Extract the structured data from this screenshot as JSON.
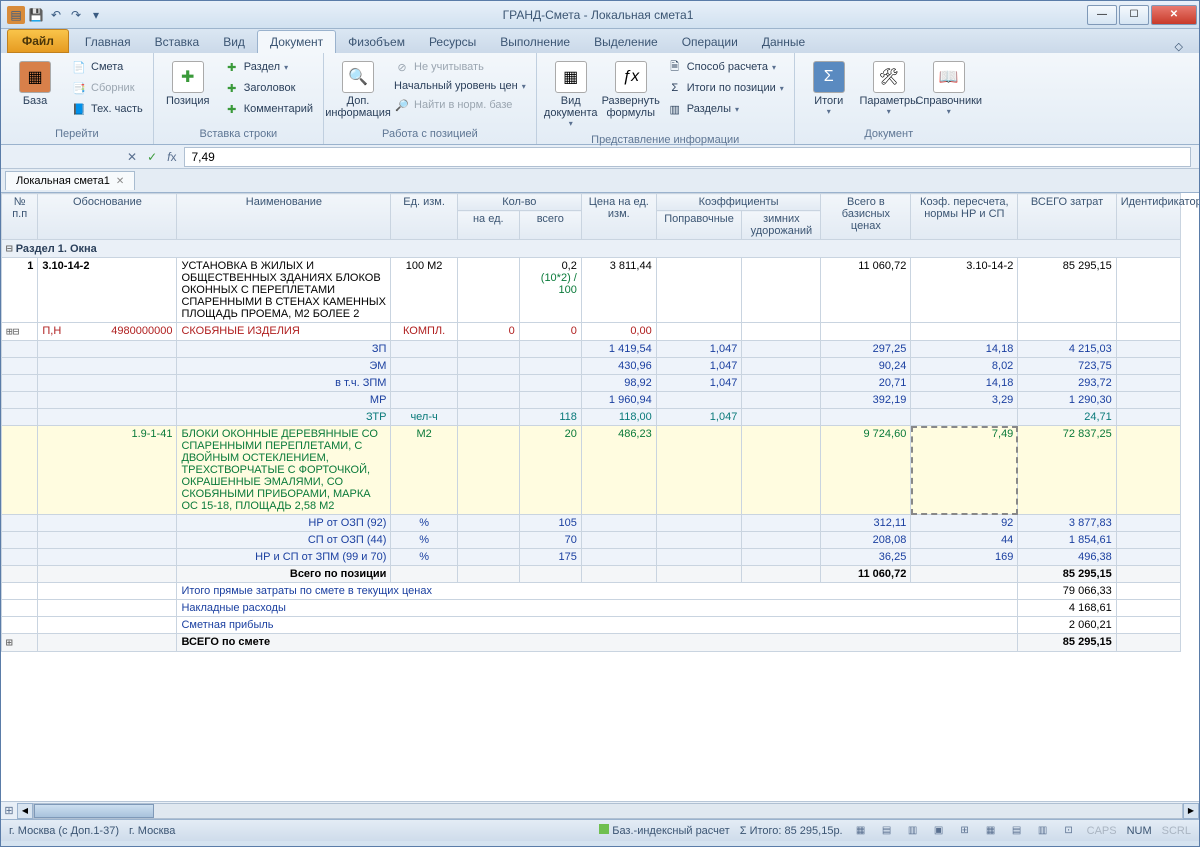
{
  "title": "ГРАНД-Смета - Локальная смета1",
  "tabs": {
    "file": "Файл",
    "main": "Главная",
    "insert": "Вставка",
    "view": "Вид",
    "document": "Документ",
    "phys": "Физобъем",
    "res": "Ресурсы",
    "exec": "Выполнение",
    "select": "Выделение",
    "ops": "Операции",
    "data": "Данные"
  },
  "ribbon": {
    "g1": {
      "baza": "База",
      "smeta": "Смета",
      "sbornik": "Сборник",
      "tech": "Тех. часть",
      "title": "Перейти"
    },
    "g2": {
      "pos": "Позиция",
      "razdel": "Раздел",
      "zag": "Заголовок",
      "kom": "Комментарий",
      "title": "Вставка строки"
    },
    "g3": {
      "dop": "Доп.\nинформация",
      "ne": "Не учитывать",
      "nach": "Начальный уровень цен",
      "najti": "Найти в норм. базе",
      "title": "Работа с позицией"
    },
    "g4": {
      "viddoc": "Вид\nдокумента",
      "razv": "Развернуть\nформулы",
      "spos": "Способ расчета",
      "itogi": "Итоги по позиции",
      "razd": "Разделы",
      "title": "Представление информации"
    },
    "g5": {
      "itog": "Итоги",
      "param": "Параметры",
      "sprav": "Справочники",
      "title": "Документ"
    }
  },
  "formula": {
    "value": "7,49"
  },
  "doctab": "Локальная смета1",
  "headers": {
    "npp": "№\nп.п",
    "obos": "Обоснование",
    "naim": "Наименование",
    "ed": "Ед. изм.",
    "kolvo": "Кол-во",
    "naed": "на ед.",
    "vsego": "всего",
    "cena": "Цена на ед. изм.",
    "koef": "Коэффициенты",
    "popr": "Поправочные",
    "zim": "зимних удорожаний",
    "vsegobaz": "Всего в базисных ценах",
    "kper": "Коэф. пересчета, нормы НР и СП",
    "vzat": "ВСЕГО затрат",
    "ident": "Идентификатор"
  },
  "section1": "Раздел 1. Окна",
  "rows": [
    {
      "n": "1",
      "obos": "3.10-14-2",
      "naim": "УСТАНОВКА В ЖИЛЫХ И ОБЩЕСТВЕННЫХ ЗДАНИЯХ БЛОКОВ ОКОННЫХ С ПЕРЕПЛЕТАМИ СПАРЕННЫМИ В СТЕНАХ КАМЕННЫХ ПЛОЩАДЬ ПРОЕМА, М2 БОЛЕЕ 2",
      "ed": "100 М2",
      "vsego": "0,2",
      "formula": "(10*2) / 100",
      "cena": "3 811,44",
      "baz": "11 060,72",
      "kper": "3.10-14-2",
      "zat": "85 295,15"
    },
    {
      "type": "red",
      "pn": "П,Н",
      "code": "4980000000",
      "naim": "СКОБЯНЫЕ ИЗДЕЛИЯ",
      "ed": "КОМПЛ.",
      "naed": "0",
      "vsego": "0",
      "cena": "0,00"
    },
    {
      "type": "sub",
      "naim": "ЗП",
      "cena": "1 419,54",
      "popr": "1,047",
      "baz": "297,25",
      "kper": "14,18",
      "zat": "4 215,03"
    },
    {
      "type": "sub",
      "naim": "ЭМ",
      "cena": "430,96",
      "popr": "1,047",
      "baz": "90,24",
      "kper": "8,02",
      "zat": "723,75"
    },
    {
      "type": "sub",
      "naim": "в т.ч. ЗПМ",
      "cena": "98,92",
      "popr": "1,047",
      "baz": "20,71",
      "kper": "14,18",
      "zat": "293,72"
    },
    {
      "type": "sub",
      "naim": "МР",
      "cena": "1 960,94",
      "baz": "392,19",
      "kper": "3,29",
      "zat": "1 290,30"
    },
    {
      "type": "teal",
      "naim": "ЗТР",
      "ed": "чел-ч",
      "vsego": "118",
      "cena": "118,00",
      "popr": "1,047",
      "zat": "24,71"
    },
    {
      "type": "green",
      "obos": "1.9-1-41",
      "naim": "БЛОКИ ОКОННЫЕ ДЕРЕВЯННЫЕ СО СПАРЕННЫМИ ПЕРЕПЛЕТАМИ, С ДВОЙНЫМ ОСТЕКЛЕНИЕМ, ТРЕХСТВОРЧАТЫЕ С ФОРТОЧКОЙ, ОКРАШЕННЫЕ ЭМАЛЯМИ, СО СКОБЯНЫМИ ПРИБОРАМИ, МАРКА ОС 15-18, ПЛОЩАДЬ 2,58 М2",
      "ed": "М2",
      "vsego": "20",
      "cena": "486,23",
      "baz": "9 724,60",
      "kper": "7,49",
      "zat": "72 837,25"
    },
    {
      "type": "sub",
      "naim": "НР от ОЗП (92)",
      "ed": "%",
      "vsego": "105",
      "baz": "312,11",
      "kper": "92",
      "zat": "3 877,83"
    },
    {
      "type": "sub",
      "naim": "СП от ОЗП (44)",
      "ed": "%",
      "vsego": "70",
      "baz": "208,08",
      "kper": "44",
      "zat": "1 854,61"
    },
    {
      "type": "sub",
      "naim": "НР и СП от ЗПМ (99 и 70)",
      "ed": "%",
      "vsego": "175",
      "baz": "36,25",
      "kper": "169",
      "zat": "496,38"
    }
  ],
  "totals": {
    "pozlabel": "Всего по позиции",
    "pozbaz": "11 060,72",
    "pozzat": "85 295,15",
    "pr": "Итого прямые затраты по смете в текущих ценах",
    "prv": "79 066,33",
    "nr": "Накладные расходы",
    "nrv": "4 168,61",
    "sp": "Сметная прибыль",
    "spv": "2 060,21",
    "all": "ВСЕГО по смете",
    "allv": "85 295,15"
  },
  "status": {
    "loc1": "г. Москва (с Доп.1-37)",
    "loc2": "г. Москва",
    "calc": "Баз.-индексный расчет",
    "itogo": "Итого: 85 295,15р.",
    "caps": "CAPS",
    "num": "NUM",
    "scrl": "SCRL"
  }
}
